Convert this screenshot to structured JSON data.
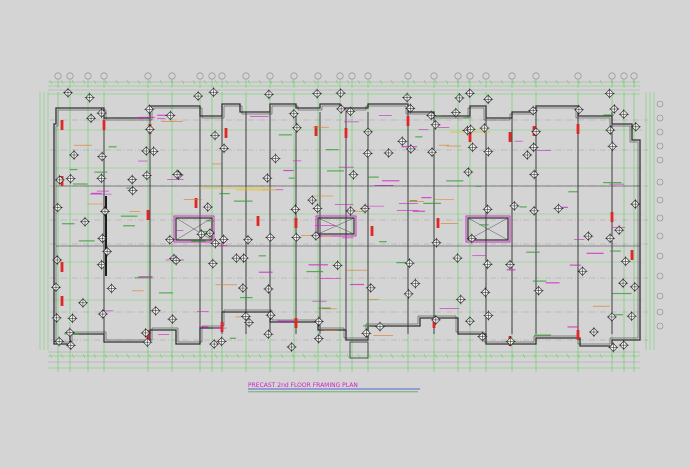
{
  "drawing": {
    "title": "PRECAST 2nd FLOOR FRAMING PLAN",
    "background": "#d4d4d4",
    "colors": {
      "gridline": "#2fd62f",
      "wall": "#303030",
      "red": "#e02626",
      "magenta": "#d11ec8",
      "orange": "#e07a1c",
      "yellow": "#d8c21a",
      "blue": "#2a3fd6",
      "grey": "#8a8a8a"
    },
    "symbols": [
      "column-marker-icon",
      "grid-bubble-icon",
      "elevator-core-icon",
      "stair-box-icon"
    ]
  }
}
